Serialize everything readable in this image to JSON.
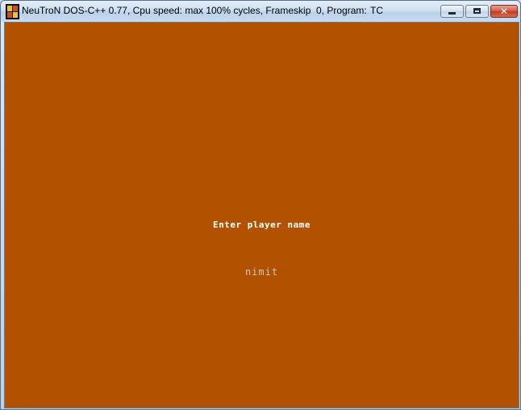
{
  "window": {
    "title": "NeuTroN DOS-C++ 0.77, Cpu speed: max 100% cycles, Frameskip  0, Program:",
    "program": "TC",
    "icon": "dosbox-icon",
    "controls": [
      "minimize-icon",
      "maximize-icon",
      "close-icon"
    ]
  },
  "screen": {
    "background": "#b25200",
    "prompt": "Enter player name",
    "player_name": "nimit",
    "prompt_color": "#ffffff",
    "name_color": "#c8c8c8"
  }
}
